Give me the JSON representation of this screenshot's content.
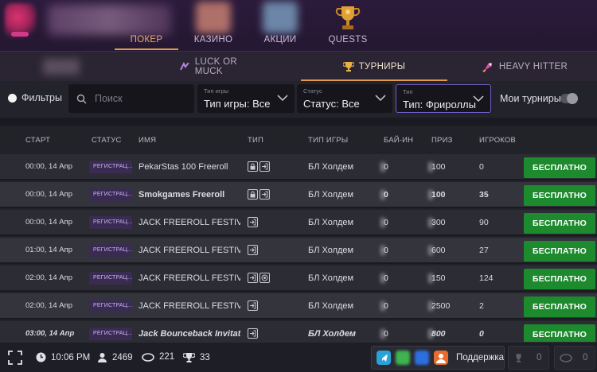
{
  "topnav": {
    "items": [
      {
        "label": "ПОКЕР",
        "active": true
      },
      {
        "label": "КАЗИНО",
        "active": false
      },
      {
        "label": "АКЦИИ",
        "active": false
      },
      {
        "label": "QUESTS",
        "active": false
      }
    ]
  },
  "subtabs": [
    {
      "label": "LUCK OR MUCK",
      "icon": "cards-icon"
    },
    {
      "label": "ТУРНИРЫ",
      "icon": "trophy-icon",
      "active": true
    },
    {
      "label": "HEAVY HITTER",
      "icon": "rocket-icon"
    }
  ],
  "filters": {
    "filters_label": "Фильтры",
    "search_placeholder": "Поиск",
    "game_type": {
      "caption": "Тип игры",
      "value": "Тип игры: Все"
    },
    "status": {
      "caption": "Статус",
      "value": "Статус: Все"
    },
    "type": {
      "caption": "Тип",
      "value": "Тип: Фрироллы"
    },
    "my_tournaments": "Мои турниры"
  },
  "table": {
    "headers": [
      "СТАРТ",
      "СТАТУС",
      "ИМЯ",
      "ТИП",
      "ТИП ИГРЫ",
      "БАЙ-ИН",
      "ПРИЗ",
      "ИГРОКОВ"
    ],
    "rows": [
      {
        "start": "00:00, 14 Апр",
        "status": "РЕГИСТРАЦ...",
        "name": "PekarStas 100 Freeroll",
        "type_icons": [
          "lock-icon",
          "enter-icon"
        ],
        "game": "БЛ Холдем",
        "buyin": "0",
        "prize": "100",
        "players": "0",
        "action": "БЕСПЛАТНО"
      },
      {
        "start": "00:00, 14 Апр",
        "status": "РЕГИСТРАЦ...",
        "name": "Smokgames Freeroll",
        "type_icons": [
          "lock-icon",
          "enter-icon"
        ],
        "game": "БЛ Холдем",
        "buyin": "0",
        "prize": "100",
        "players": "35",
        "action": "БЕСПЛАТНО"
      },
      {
        "start": "00:00, 14 Апр",
        "status": "РЕГИСТРАЦ...",
        "name": "JACK FREEROLL FESTIVA...",
        "type_icons": [
          "enter-icon"
        ],
        "game": "БЛ Холдем",
        "buyin": "0",
        "prize": "300",
        "players": "90",
        "action": "БЕСПЛАТНО"
      },
      {
        "start": "01:00, 14 Апр",
        "status": "РЕГИСТРАЦ...",
        "name": "JACK FREEROLL FESTIVA...",
        "type_icons": [
          "enter-icon"
        ],
        "game": "БЛ Холдем",
        "buyin": "0",
        "prize": "600",
        "players": "27",
        "action": "БЕСПЛАТНО"
      },
      {
        "start": "02:00, 14 Апр",
        "status": "РЕГИСТРАЦ...",
        "name": "JACK FREEROLL FESTIVA...",
        "type_icons": [
          "enter-icon",
          "bounty-icon"
        ],
        "game": "БЛ Холдем",
        "buyin": "0",
        "prize": "150",
        "players": "124",
        "action": "БЕСПЛАТНО"
      },
      {
        "start": "02:00, 14 Апр",
        "status": "РЕГИСТРАЦ...",
        "name": "JACK FREEROLL FESTIVA...",
        "type_icons": [
          "enter-icon"
        ],
        "game": "БЛ Холдем",
        "buyin": "0",
        "prize": "2500",
        "players": "2",
        "action": "БЕСПЛАТНО"
      },
      {
        "start": "03:00, 14 Апр",
        "status": "РЕГИСТРАЦ...",
        "name": "Jack Bounceback Invitati...",
        "type_icons": [
          "enter-icon"
        ],
        "game": "БЛ Холдем",
        "buyin": "0",
        "prize": "800",
        "players": "0",
        "action": "БЕСПЛАТНО"
      }
    ]
  },
  "bottombar": {
    "time": "10:06 PM",
    "players_online": "2469",
    "tables": "221",
    "tournaments": "33",
    "support_label": "Поддержка",
    "count_1": "0",
    "count_2": "0"
  },
  "colors": {
    "accent": "#e49a4b",
    "free_button": "#1d8a2e",
    "status_badge_bg": "#3a2b52",
    "focus_border": "#6d5fc7"
  }
}
